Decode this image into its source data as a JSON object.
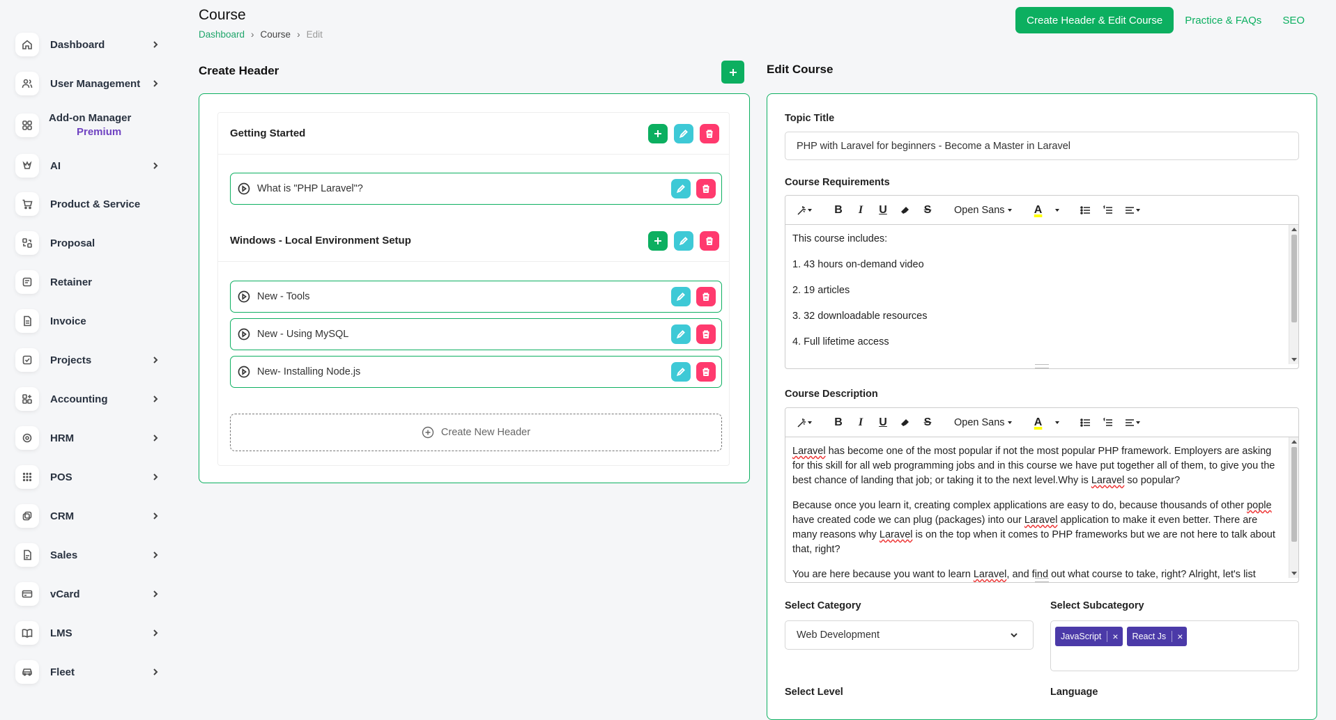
{
  "sidebar": {
    "items": [
      {
        "label": "Dashboard",
        "icon": "home-icon",
        "has_submenu": true
      },
      {
        "label": "User Management",
        "icon": "users-icon",
        "has_submenu": true
      },
      {
        "label": "Add-on Manager",
        "sublabel": "Premium",
        "icon": "grid-icon",
        "has_submenu": false
      },
      {
        "label": "AI",
        "icon": "ai-icon",
        "has_submenu": true
      },
      {
        "label": "Product & Service",
        "icon": "cart-icon",
        "has_submenu": false
      },
      {
        "label": "Proposal",
        "icon": "proposal-icon",
        "has_submenu": false
      },
      {
        "label": "Retainer",
        "icon": "retainer-icon",
        "has_submenu": false
      },
      {
        "label": "Invoice",
        "icon": "invoice-icon",
        "has_submenu": false
      },
      {
        "label": "Projects",
        "icon": "projects-icon",
        "has_submenu": true
      },
      {
        "label": "Accounting",
        "icon": "accounting-icon",
        "has_submenu": true
      },
      {
        "label": "HRM",
        "icon": "hrm-icon",
        "has_submenu": true
      },
      {
        "label": "POS",
        "icon": "pos-icon",
        "has_submenu": true
      },
      {
        "label": "CRM",
        "icon": "crm-icon",
        "has_submenu": true
      },
      {
        "label": "Sales",
        "icon": "sales-icon",
        "has_submenu": true
      },
      {
        "label": "vCard",
        "icon": "vcard-icon",
        "has_submenu": true
      },
      {
        "label": "LMS",
        "icon": "book-icon",
        "has_submenu": true
      },
      {
        "label": "Fleet",
        "icon": "car-icon",
        "has_submenu": true
      }
    ]
  },
  "header": {
    "title": "Course",
    "breadcrumb": [
      "Dashboard",
      "Course",
      "Edit"
    ],
    "actions": {
      "primary": "Create Header & Edit Course",
      "tab_practice": "Practice & FAQs",
      "tab_seo": "SEO"
    }
  },
  "create_header": {
    "title": "Create Header",
    "groups": [
      {
        "title": "Getting Started",
        "lessons": [
          "What is \"PHP Laravel\"?"
        ]
      },
      {
        "title": "Windows - Local Environment Setup",
        "lessons": [
          "New - Tools",
          "New - Using MySQL",
          "New- Installing Node.js"
        ]
      }
    ],
    "create_new_label": "Create New Header"
  },
  "edit_course": {
    "title": "Edit Course",
    "topic_title_label": "Topic Title",
    "topic_title_value": "PHP with Laravel for beginners - Become a Master in Laravel",
    "requirements_label": "Course Requirements",
    "requirements_lines": [
      "This course includes:",
      "1. 43 hours on-demand video",
      "2. 19 articles",
      "3. 32 downloadable resources",
      "4. Full lifetime access"
    ],
    "description_label": "Course Description",
    "description_paragraphs": [
      "Laravel has become one of the most popular if not the most popular PHP framework. Employers are asking for this skill for all web programming jobs and in this course we have put together all of them, to give you the best chance of landing that job; or taking it to the next level.Why is Laravel so popular?",
      "Because once you learn it, creating complex applications are easy to do, because thousands of other pople have created code we can plug (packages) into our Laravel application to make it even better. There are many reasons why Laravel is on the top when it comes to PHP frameworks but we are not here to talk about that, right?",
      "You are here because you want to learn Laravel, and find out what course to take, right? Alright, let's list"
    ],
    "toolbar_font": "Open Sans",
    "category_label": "Select Category",
    "category_value": "Web Development",
    "subcategory_label": "Select Subcategory",
    "subcategory_tags": [
      "JavaScript",
      "React Js"
    ],
    "level_label": "Select Level",
    "language_label": "Language"
  },
  "colors": {
    "accent": "#0caf60",
    "info": "#3ec9d6",
    "danger": "#ff3a6e",
    "tag": "#4b3aa8",
    "premium": "#6f42c1"
  }
}
